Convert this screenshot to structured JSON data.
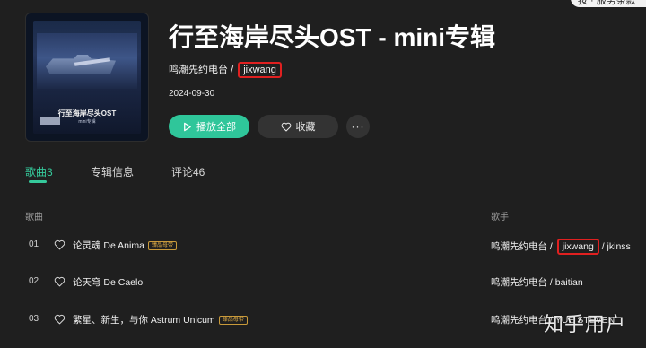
{
  "top_widget": {
    "text": "按 · 服务条款"
  },
  "album": {
    "cover_title": "行至海岸尽头OST",
    "cover_subtitle": "mini专辑",
    "title": "行至海岸尽头OST - mini专辑",
    "artist_primary": "鸣潮先约电台",
    "artist_separator": "/",
    "artist_secondary": "jixwang",
    "date": "2024-09-30"
  },
  "actions": {
    "play_all": "播放全部",
    "favorite": "收藏",
    "more": "···"
  },
  "tabs": [
    {
      "label": "歌曲3"
    },
    {
      "label": "专辑信息"
    },
    {
      "label": "评论46"
    }
  ],
  "table": {
    "col_song": "歌曲",
    "col_singer": "歌手",
    "rows": [
      {
        "num": "01",
        "title": "论灵魂 De Anima",
        "badge": "臻品母带",
        "singer_a": "鸣潮先约电台 / ",
        "singer_b": "jixwang",
        "singer_c": " / jkinss"
      },
      {
        "num": "02",
        "title": "论天穹 De Caelo",
        "badge": "",
        "singer_a": "鸣潮先约电台 / baitian",
        "singer_b": "",
        "singer_c": ""
      },
      {
        "num": "03",
        "title": "繁星、新生，与你 Astrum Unicum",
        "badge": "臻品母带",
        "singer_a": "鸣潮先约电台 / YUE STEVEN",
        "singer_b": "",
        "singer_c": ""
      }
    ]
  },
  "watermark": "知乎用户",
  "colors": {
    "accent": "#35c99b",
    "play_button": "#2fc69a",
    "highlight_box": "#e02020",
    "badge": "#d9a845"
  }
}
